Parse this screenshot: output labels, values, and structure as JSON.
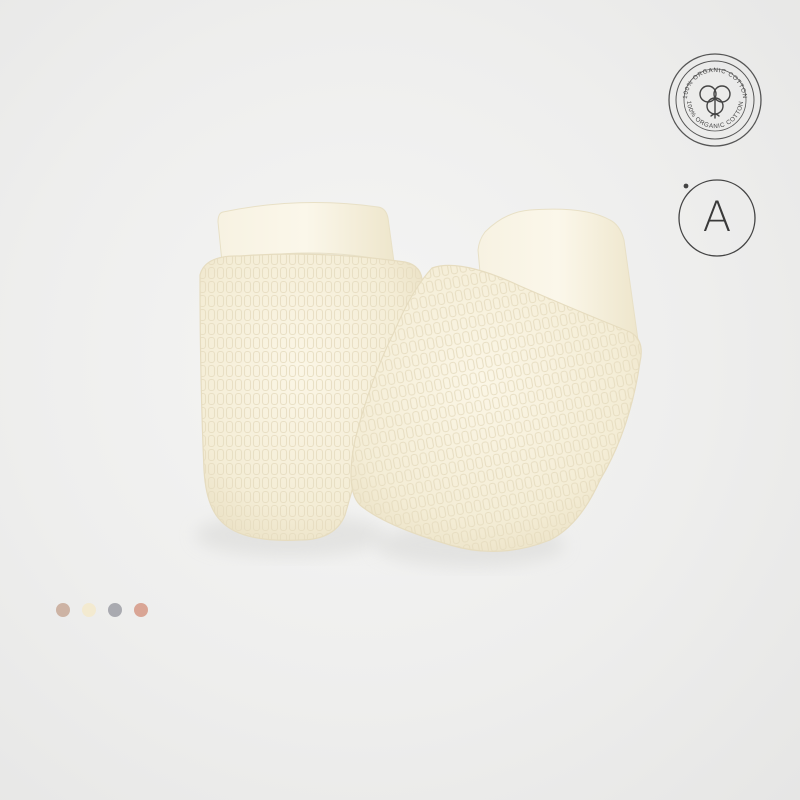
{
  "badges": {
    "organic": {
      "text": "100% ORGANIC COTTON",
      "icon": "cotton-flower-icon",
      "color": "#4a4a4a"
    },
    "variant": {
      "letter": "A",
      "color": "#3a3a3a"
    }
  },
  "product": {
    "name": "baby-mittens",
    "color": "#f6f0dc"
  },
  "swatches": [
    {
      "name": "tan",
      "color": "#cdb3a4"
    },
    {
      "name": "cream",
      "color": "#f3ead0"
    },
    {
      "name": "grey",
      "color": "#a9aab0"
    },
    {
      "name": "coral",
      "color": "#d9a595"
    }
  ]
}
